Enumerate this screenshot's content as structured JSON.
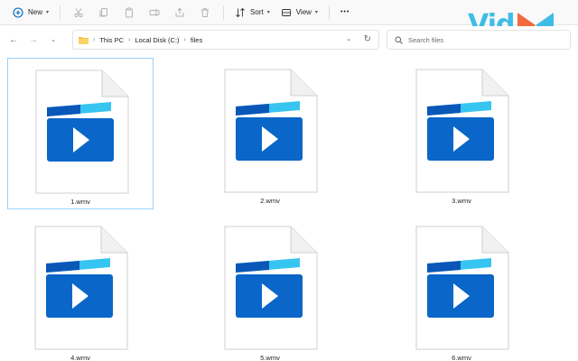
{
  "toolbar": {
    "new_label": "New",
    "sort_label": "Sort",
    "view_label": "View",
    "more_label": "•••"
  },
  "logo": {
    "text": "Vid"
  },
  "nav": {
    "back_icon": "arrow-left-icon",
    "forward_icon": "arrow-right-icon",
    "recent_icon": "chevron-down-icon",
    "up_icon": "arrow-up-icon"
  },
  "address": {
    "crumbs": [
      "This PC",
      "Local Disk (C:)",
      "files"
    ]
  },
  "search": {
    "placeholder": "Search files"
  },
  "files": [
    {
      "name": "1.wmv",
      "selected": true
    },
    {
      "name": "2.wmv",
      "selected": false
    },
    {
      "name": "3.wmv",
      "selected": false
    },
    {
      "name": "4.wmv",
      "selected": false
    },
    {
      "name": "5.wmv",
      "selected": false
    },
    {
      "name": "6.wmv",
      "selected": false
    }
  ],
  "colors": {
    "accent": "#0067c0",
    "clapper_dark": "#0a57b8",
    "clapper_light": "#36c5f0",
    "logo_text": "#3fbde6",
    "logo_orange": "#f26a3d"
  }
}
